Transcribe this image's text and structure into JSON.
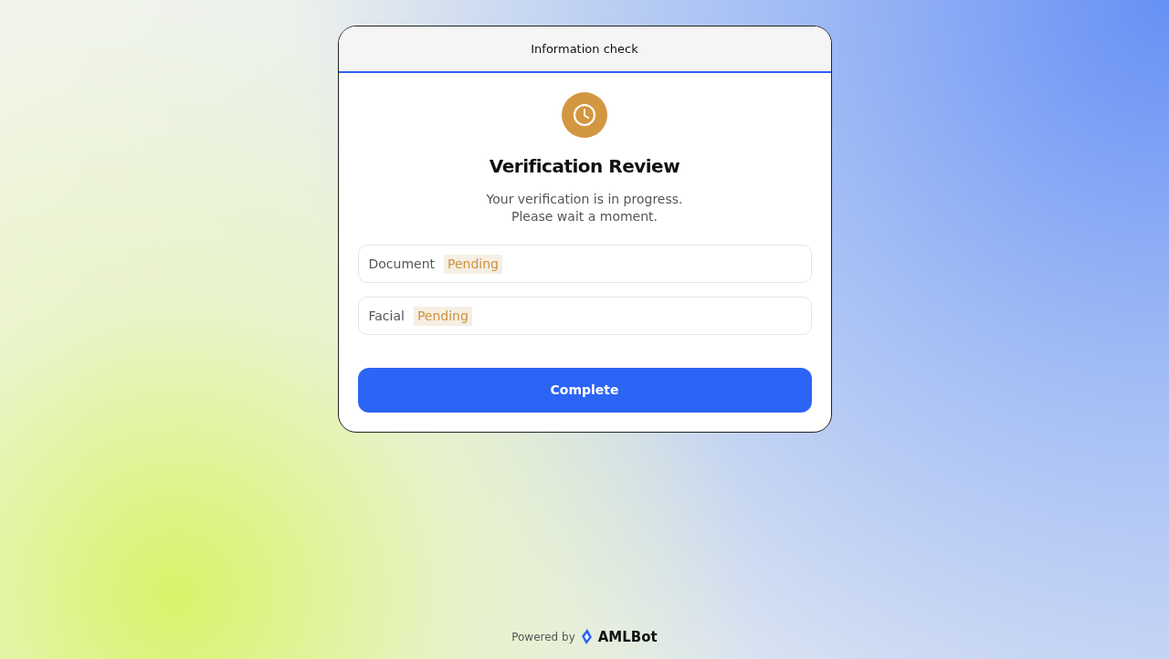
{
  "header": {
    "title": "Information check"
  },
  "status": {
    "title": "Verification Review",
    "message_lines": [
      "Your verification is in progress.",
      "Please wait a moment."
    ]
  },
  "checks": [
    {
      "label": "Document",
      "status": "Pending",
      "kind": "pending"
    },
    {
      "label": "Facial",
      "status": "Pending",
      "kind": "pending"
    }
  ],
  "primary_button": "Complete",
  "footer": {
    "powered_by": "Powered by",
    "brand": "AMLBot"
  }
}
